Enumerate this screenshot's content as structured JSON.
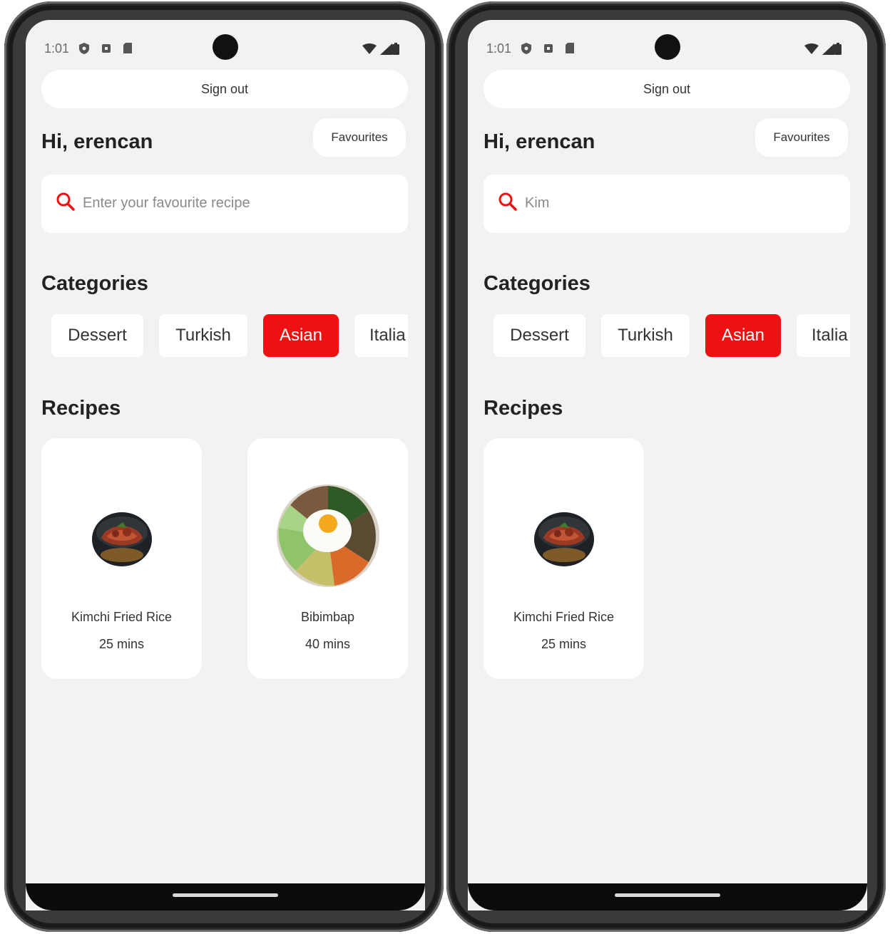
{
  "colors": {
    "accent": "#ee1111",
    "background": "#f2f2f2",
    "card": "#ffffff"
  },
  "screens": [
    {
      "status": {
        "time": "1:01"
      },
      "sign_out_label": "Sign out",
      "greeting": "Hi, erencan",
      "favourites_label": "Favourites",
      "search": {
        "text": "Enter your favourite recipe",
        "is_placeholder": true
      },
      "categories_title": "Categories",
      "categories": [
        {
          "label": "Dessert",
          "active": false
        },
        {
          "label": "Turkish",
          "active": false
        },
        {
          "label": "Asian",
          "active": true
        },
        {
          "label": "Italia",
          "active": false
        }
      ],
      "recipes_title": "Recipes",
      "recipes": [
        {
          "name": "Kimchi Fried Rice",
          "time": "25 mins",
          "image": "kimchi-fried-rice-bowl"
        },
        {
          "name": "Bibimbap",
          "time": "40 mins",
          "image": "bibimbap-plate"
        }
      ]
    },
    {
      "status": {
        "time": "1:01"
      },
      "sign_out_label": "Sign out",
      "greeting": "Hi, erencan",
      "favourites_label": "Favourites",
      "search": {
        "text": "Kim",
        "is_placeholder": false
      },
      "categories_title": "Categories",
      "categories": [
        {
          "label": "Dessert",
          "active": false
        },
        {
          "label": "Turkish",
          "active": false
        },
        {
          "label": "Asian",
          "active": true
        },
        {
          "label": "Italia",
          "active": false
        }
      ],
      "recipes_title": "Recipes",
      "recipes": [
        {
          "name": "Kimchi Fried Rice",
          "time": "25 mins",
          "image": "kimchi-fried-rice-bowl"
        }
      ]
    }
  ]
}
